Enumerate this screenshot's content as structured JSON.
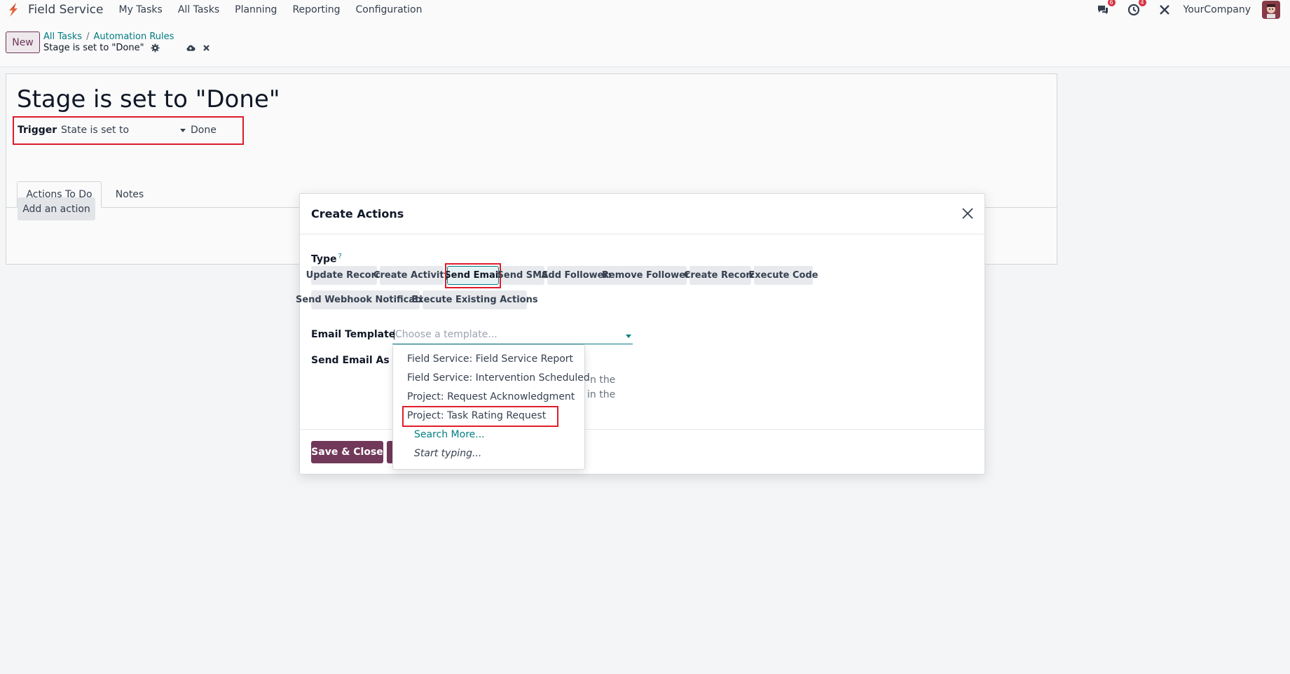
{
  "navbar": {
    "app_name": "Field Service",
    "menu": [
      "My Tasks",
      "All Tasks",
      "Planning",
      "Reporting",
      "Configuration"
    ],
    "messages_badge": "6",
    "activities_badge": "4",
    "company": "YourCompany",
    "brand_color": "#71385a"
  },
  "control": {
    "new_label": "New",
    "breadcrumb": [
      "All Tasks",
      "Automation Rules"
    ],
    "breadcrumb_sep": "/",
    "record_name": "Stage is set to \"Done\""
  },
  "form": {
    "title": "Stage is set to \"Done\"",
    "trigger_label": "Trigger",
    "trigger_value": "State is set to",
    "trigger_target": "Done",
    "tabs": [
      "Actions To Do",
      "Notes"
    ],
    "add_action_label": "Add an action"
  },
  "modal": {
    "title": "Create Actions",
    "type_label": "Type",
    "type_help": "?",
    "types": [
      "Update Record",
      "Create Activity",
      "Send Email",
      "Send SMS",
      "Add Followers",
      "Remove Followers",
      "Create Record",
      "Execute Code",
      "Send Webhook Notification",
      "Execute Existing Actions"
    ],
    "selected_type": "Send Email",
    "email_template_label": "Email Template",
    "email_template_placeholder": "Choose a template...",
    "send_as_label": "Send Email As",
    "partial_text_1": "n the",
    "partial_text_2": "in the",
    "save_close_label": "Save & Close"
  },
  "dropdown": {
    "items": [
      "Field Service: Field Service Report",
      "Field Service: Intervention Scheduled",
      "Project: Request Acknowledgment",
      "Project: Task Rating Request"
    ],
    "highlighted_item": "Project: Task Rating Request",
    "search_more": "Search More...",
    "start_typing": "Start typing..."
  }
}
